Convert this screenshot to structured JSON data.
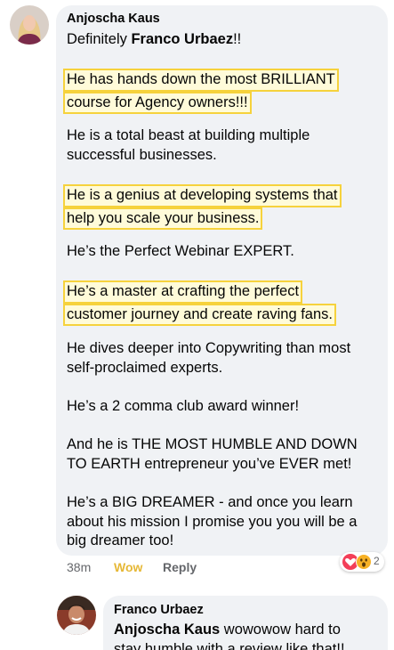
{
  "comment": {
    "author": "Anjoscha Kaus",
    "line1_prefix": "Definitely ",
    "line1_mention": "Franco Urbaez",
    "line1_suffix": "!!",
    "hl1_a": "He has hands down the most BRILLIANT",
    "hl1_b": "course for Agency owners!!!",
    "p2_a": "He is a total beast at building multiple",
    "p2_b": "successful businesses.",
    "hl2_a": "He is a genius at developing systems that",
    "hl2_b": "help you scale your business.",
    "p3": "He’s the Perfect Webinar EXPERT.",
    "hl3_a": "He’s a master at crafting the perfect",
    "hl3_b": "customer journey and create raving fans.",
    "p4_a": "He dives deeper into Copywriting than most",
    "p4_b": "self-proclaimed experts.",
    "p5": "He’s a 2 comma club award winner!",
    "p6_a": "And he is THE MOST HUMBLE AND DOWN",
    "p6_b": "TO EARTH entrepreneur you’ve EVER met!",
    "p7_a": "He’s a BIG DREAMER - and once you learn",
    "p7_b": "about his mission I promise you you will be a",
    "p7_c": "big dreamer too!",
    "time": "38m",
    "reaction_label": "Wow",
    "reply_label": "Reply",
    "reaction_count": "2",
    "highlight_color": "#f6d23c"
  },
  "reply_comment": {
    "author": "Franco Urbaez",
    "mention": "Anjoscha Kaus",
    "text_a": " wowowow hard to",
    "text_b": "stay humble with a review like that!!"
  }
}
